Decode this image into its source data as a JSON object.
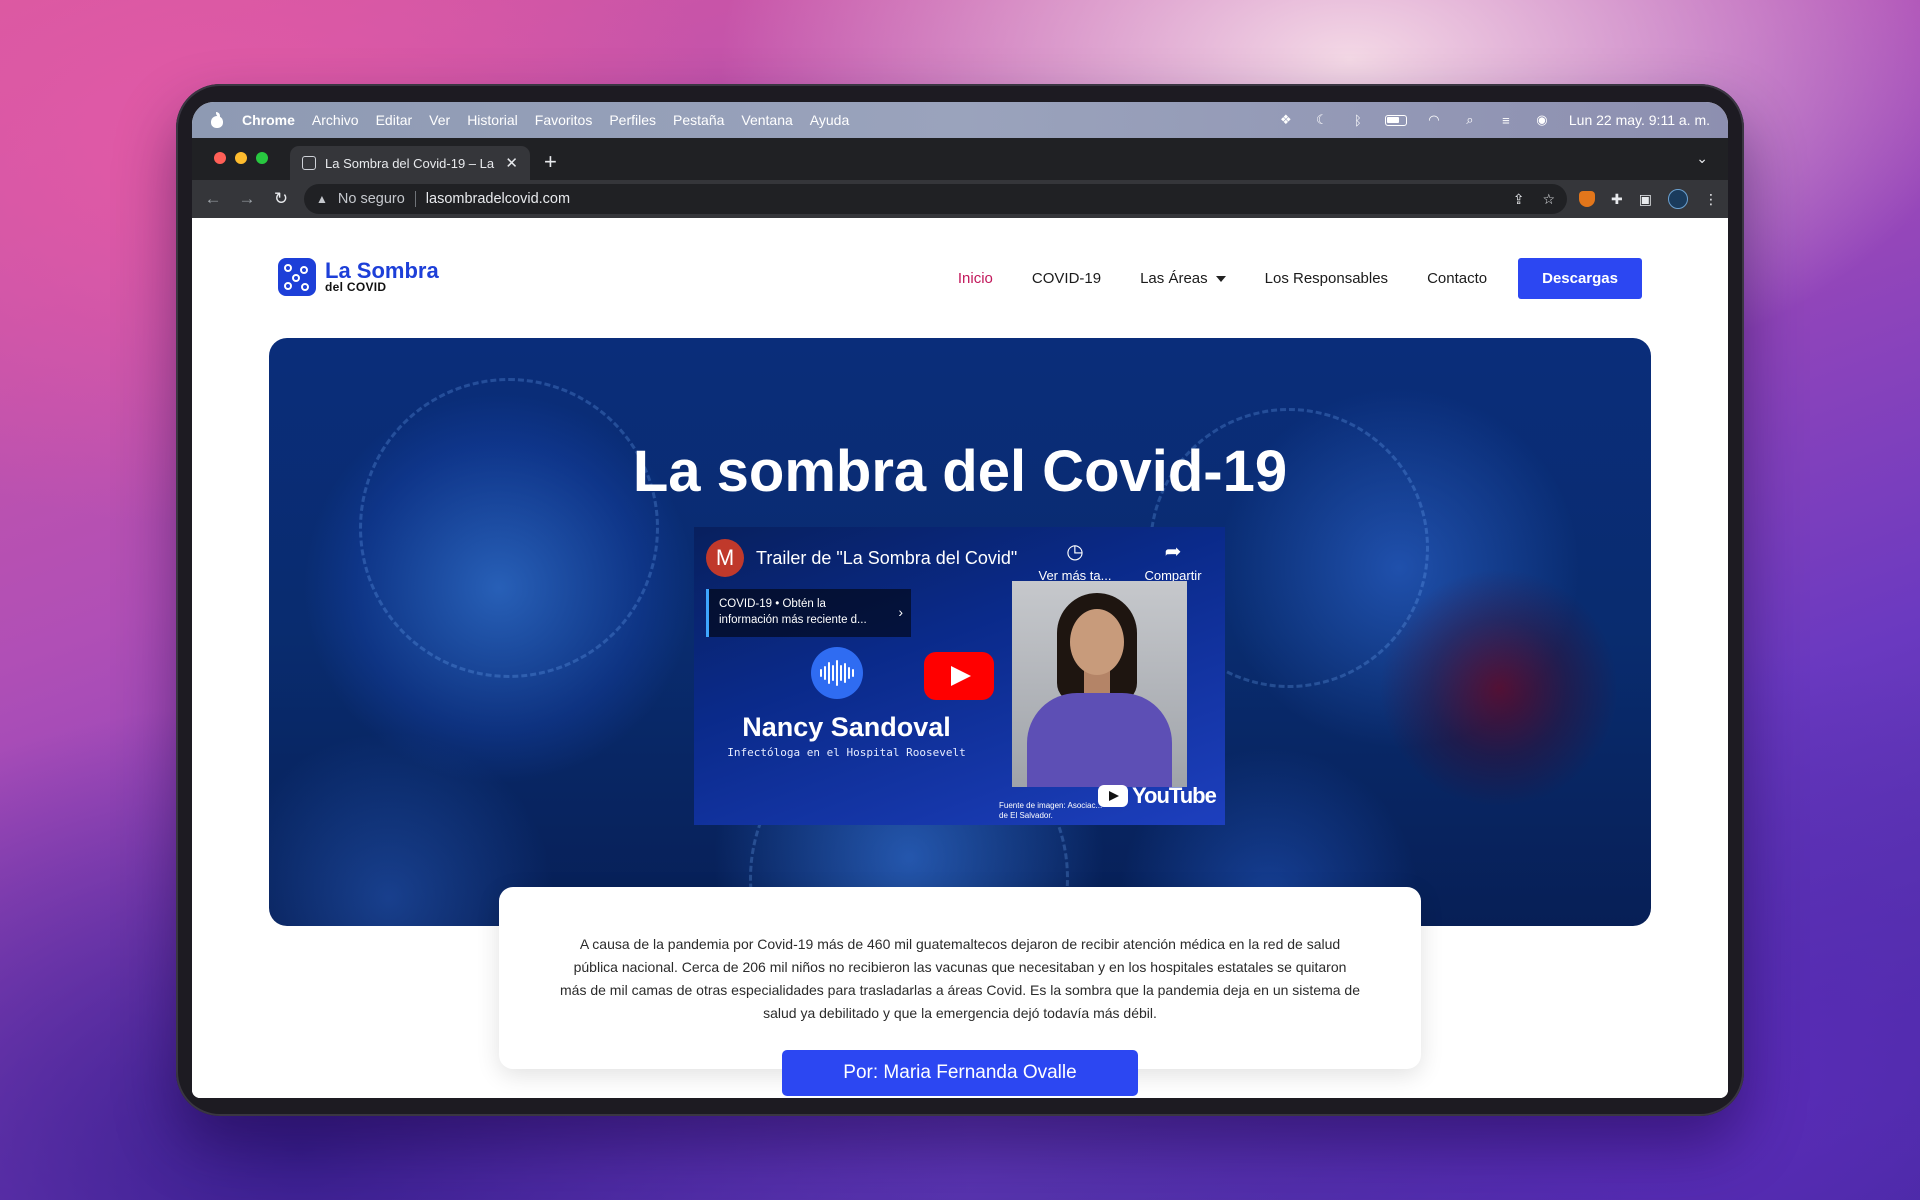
{
  "menubar": {
    "items": [
      "Chrome",
      "Archivo",
      "Editar",
      "Ver",
      "Historial",
      "Favoritos",
      "Perfiles",
      "Pestaña",
      "Ventana",
      "Ayuda"
    ],
    "clock": "Lun 22 may.  9:11 a. m."
  },
  "browser": {
    "tab_title": "La Sombra del Covid-19 – La s",
    "security_label": "No seguro",
    "url": "lasombradelcovid.com"
  },
  "site": {
    "logo_line1": "La Sombra",
    "logo_line2": "del COVID",
    "nav": [
      "Inicio",
      "COVID-19",
      "Las Áreas",
      "Los Responsables",
      "Contacto"
    ],
    "download_button": "Descargas",
    "hero_title": "La sombra del Covid-19",
    "video": {
      "channel_initial": "M",
      "title": "Trailer de \"La Sombra del Covid\"",
      "watch_later": "Ver más ta...",
      "share": "Compartir",
      "info_card_line1": "COVID-19 • Obtén la",
      "info_card_line2": "información más reciente d...",
      "person_name": "Nancy Sandoval",
      "person_role": "Infectóloga en el Hospital Roosevelt",
      "source_line1": "Fuente de imagen: Asociac...",
      "source_line2": "de El Salvador.",
      "yt_brand": "YouTube"
    },
    "summary": "A causa de la pandemia por Covid-19 más de 460 mil guatemaltecos dejaron de recibir atención médica en la red de salud pública nacional. Cerca de 206 mil niños no recibieron las vacunas que necesitaban y en los hospitales estatales se quitaron más de mil camas de otras especialidades para trasladarlas a áreas Covid. Es la sombra que la pandemia deja en un sistema de salud ya debilitado y que la emergencia dejó todavía más débil.",
    "author_button": "Por: Maria Fernanda Ovalle"
  },
  "colors": {
    "brand_blue": "#2c47f2",
    "nav_active": "#c2185b",
    "youtube_red": "#ff0000"
  }
}
